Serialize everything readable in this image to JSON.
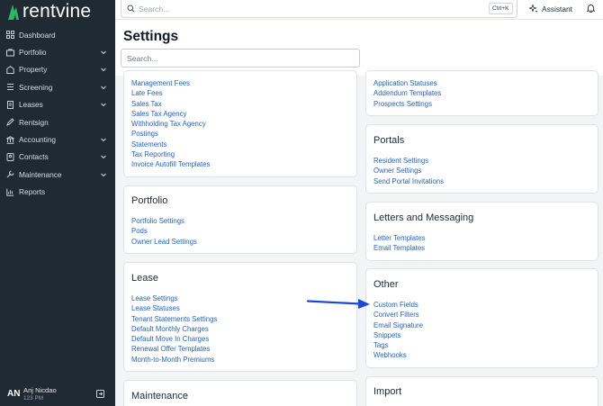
{
  "app": {
    "brand": "rentvine",
    "brand_color": "#2fb467"
  },
  "sidebar": {
    "items": [
      {
        "label": "Dashboard",
        "icon": "dashboard-icon",
        "chevron": false
      },
      {
        "label": "Portfolio",
        "icon": "portfolio-icon",
        "chevron": true
      },
      {
        "label": "Property",
        "icon": "property-icon",
        "chevron": true
      },
      {
        "label": "Screening",
        "icon": "screening-icon",
        "chevron": true
      },
      {
        "label": "Leases",
        "icon": "leases-icon",
        "chevron": true
      },
      {
        "label": "Rentsign",
        "icon": "rentsign-icon",
        "chevron": false
      },
      {
        "label": "Accounting",
        "icon": "accounting-icon",
        "chevron": true
      },
      {
        "label": "Contacts",
        "icon": "contacts-icon",
        "chevron": true
      },
      {
        "label": "Maintenance",
        "icon": "maintenance-icon",
        "chevron": true
      },
      {
        "label": "Reports",
        "icon": "reports-icon",
        "chevron": false
      }
    ],
    "user": {
      "initials": "AN",
      "name": "Anj Nicdao",
      "sub": "123 PM"
    }
  },
  "topbar": {
    "search_placeholder": "Search...",
    "shortcut": "Ctrl+K",
    "assistant_label": "Assistant"
  },
  "header": {
    "title": "Settings",
    "search_placeholder": "Search..."
  },
  "cards": {
    "accounting": {
      "links": [
        "Management Fees",
        "Late Fees",
        "Sales Tax",
        "Sales Tax Agency",
        "Withholding Tax Agency",
        "Postings",
        "Statements",
        "Tax Reporting",
        "Invoice Autofill Templates"
      ]
    },
    "screening": {
      "links": [
        "Application Statuses",
        "Addendum Templates",
        "Prospects Settings"
      ]
    },
    "portfolio": {
      "title": "Portfolio",
      "links": [
        "Portfolio Settings",
        "Pods",
        "Owner Lead Settings"
      ]
    },
    "portals": {
      "title": "Portals",
      "links": [
        "Resident Settings",
        "Owner Settings",
        "Send Portal Invitations"
      ]
    },
    "letters": {
      "title": "Letters and Messaging",
      "links": [
        "Letter Templates",
        "Email Templates"
      ]
    },
    "lease": {
      "title": "Lease",
      "links": [
        "Lease Settings",
        "Lease Statuses",
        "Tenant Statements Settings",
        "Default Monthly Charges",
        "Default Move In Charges",
        "Renewal Offer Templates",
        "Month-to-Month Premiums"
      ]
    },
    "other": {
      "title": "Other",
      "links": [
        "Custom Fields",
        "Convert Filters",
        "Email Signature",
        "Snippets",
        "Tags",
        "Webhooks"
      ]
    },
    "maintenance": {
      "title": "Maintenance"
    },
    "import": {
      "title": "Import"
    }
  },
  "colors": {
    "sidebar_bg": "#1f2a33",
    "link": "#2563c9",
    "annotation_arrow": "#1a47d6"
  }
}
